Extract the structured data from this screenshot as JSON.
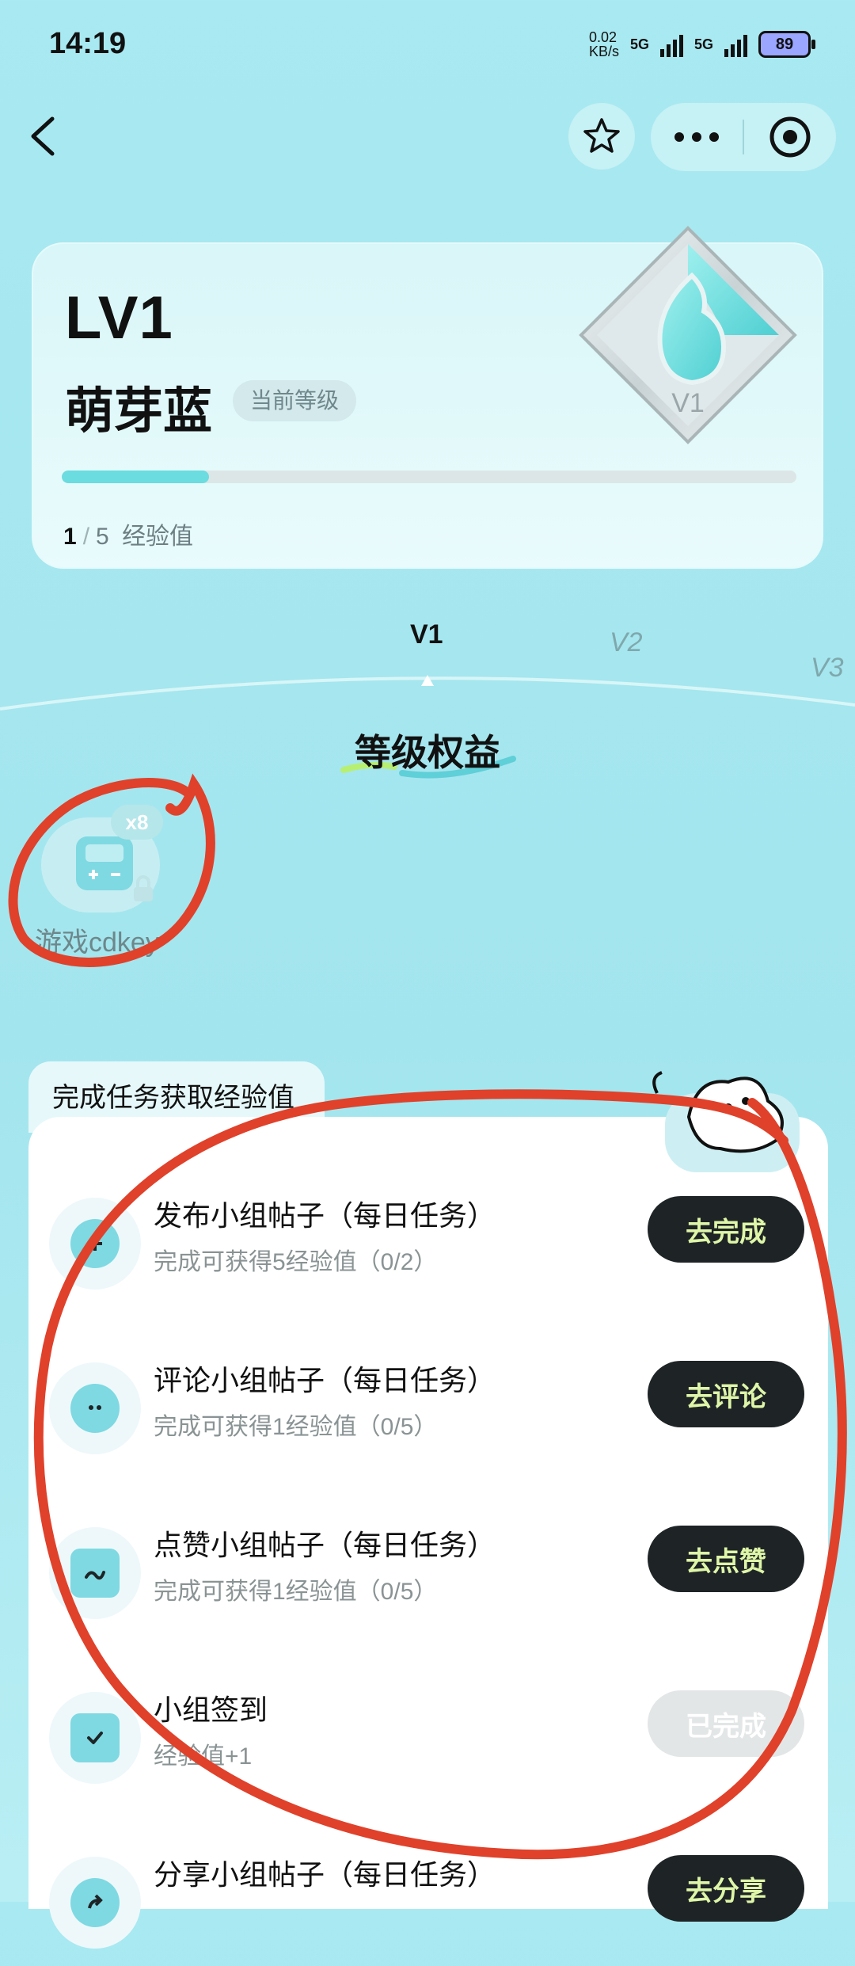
{
  "status": {
    "time": "14:19",
    "speed_top": "0.02",
    "speed_bottom": "KB/s",
    "net1": "5G",
    "net2": "5G",
    "battery": "89"
  },
  "nav": {
    "back_icon": "chevron-left-icon",
    "star_icon": "star-icon",
    "more_icon": "more-dots-icon",
    "target_icon": "target-icon"
  },
  "level": {
    "code": "LV1",
    "name": "萌芽蓝",
    "badge": "当前等级",
    "exp_current": "1",
    "exp_total": "5",
    "exp_label": "经验值",
    "progress": 0.2,
    "gem_label": "V1"
  },
  "track": {
    "v1": "V1",
    "v2": "V2",
    "v3": "V3"
  },
  "benefits": {
    "title": "等级权益",
    "items": [
      {
        "label": "游戏cdkey",
        "count": "x8",
        "icon": "gamepad-icon",
        "locked": true
      }
    ]
  },
  "tasks": {
    "tab_label": "完成任务获取经验值",
    "items": [
      {
        "title": "发布小组帖子（每日任务）",
        "desc": "完成可获得5经验值（0/2）",
        "button": "去完成",
        "icon": "plus-icon",
        "done": false
      },
      {
        "title": "评论小组帖子（每日任务）",
        "desc": "完成可获得1经验值（0/5）",
        "button": "去评论",
        "icon": "comment-icon",
        "done": false
      },
      {
        "title": "点赞小组帖子（每日任务）",
        "desc": "完成可获得1经验值（0/5）",
        "button": "去点赞",
        "icon": "like-icon",
        "done": false
      },
      {
        "title": "小组签到",
        "desc": "经验值+1",
        "button": "已完成",
        "icon": "calendar-check-icon",
        "done": true
      },
      {
        "title": "分享小组帖子（每日任务）",
        "desc": "",
        "button": "去分享",
        "icon": "share-icon",
        "done": false
      }
    ]
  },
  "colors": {
    "bg": "#a9e9f1",
    "accent": "#6bdcdf",
    "button_dark": "#1e2426",
    "button_text": "#dff6a8",
    "annotation": "#e0412b"
  }
}
